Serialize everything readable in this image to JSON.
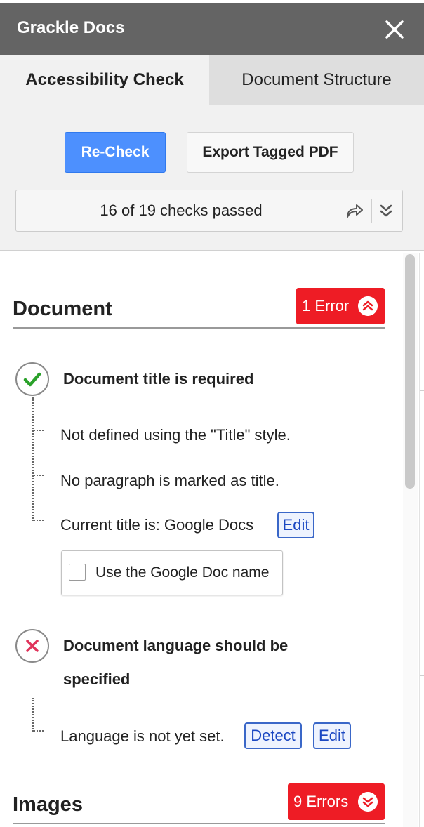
{
  "header": {
    "title": "Grackle Docs"
  },
  "tabs": [
    {
      "label": "Accessibility Check",
      "active": true
    },
    {
      "label": "Document Structure",
      "active": false
    }
  ],
  "toolbar": {
    "recheck_label": "Re-Check",
    "export_label": "Export Tagged PDF",
    "summary": "16 of 19 checks passed"
  },
  "sections": {
    "document": {
      "name": "Document",
      "badge": "1 Error",
      "checks": [
        {
          "title": "Document title is required",
          "status": "pass",
          "details": [
            "Not defined using the \"Title\" style.",
            "No paragraph is marked as title.",
            "Current title is: Google Docs"
          ],
          "edit_label": "Edit",
          "popup_checkbox_label": "Use the Google Doc name"
        },
        {
          "title_line1": "Document language should be",
          "title_line2": "specified",
          "status": "fail",
          "details": [
            "Language is not yet set."
          ],
          "detect_label": "Detect",
          "edit_label": "Edit"
        }
      ]
    },
    "images": {
      "name": "Images",
      "badge": "9 Errors"
    }
  },
  "colors": {
    "titlebar": "#646464",
    "accent_blue": "#4d90fe",
    "error_red": "#ee1c25",
    "pass_green": "#2aa12a",
    "fail_red": "#e0345b"
  },
  "icons": {
    "close": "close-icon",
    "share": "share-icon",
    "expand": "double-chevron-down-icon",
    "collapse": "double-chevron-up-icon",
    "pass": "checkmark-icon",
    "fail": "cross-icon"
  }
}
